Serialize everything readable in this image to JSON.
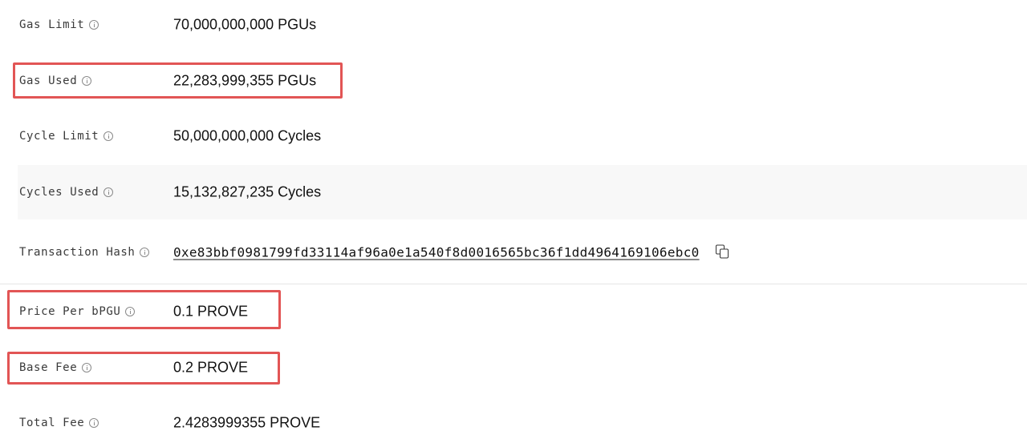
{
  "rows": [
    {
      "id": "gas-limit",
      "label": "Gas Limit",
      "value": "70,000,000,000 PGUs"
    },
    {
      "id": "gas-used",
      "label": "Gas Used",
      "value": "22,283,999,355 PGUs"
    },
    {
      "id": "cycle-limit",
      "label": "Cycle Limit",
      "value": "50,000,000,000 Cycles"
    },
    {
      "id": "cycles-used",
      "label": "Cycles Used",
      "value": "15,132,827,235 Cycles"
    },
    {
      "id": "transaction-hash",
      "label": "Transaction Hash",
      "value": "0xe83bbf0981799fd33114af96a0e1a540f8d0016565bc36f1dd4964169106ebc0"
    },
    {
      "id": "price-per-bpgu",
      "label": "Price Per bPGU",
      "value": "0.1 PROVE"
    },
    {
      "id": "base-fee",
      "label": "Base Fee",
      "value": "0.2 PROVE"
    },
    {
      "id": "total-fee",
      "label": "Total Fee",
      "value": "2.4283999355 PROVE"
    }
  ],
  "icons": {
    "info": "info-circle-icon",
    "copy": "copy-icon"
  },
  "colors": {
    "highlight": "#e25555",
    "shaded_row": "#f8f8f8",
    "text": "#111111"
  }
}
